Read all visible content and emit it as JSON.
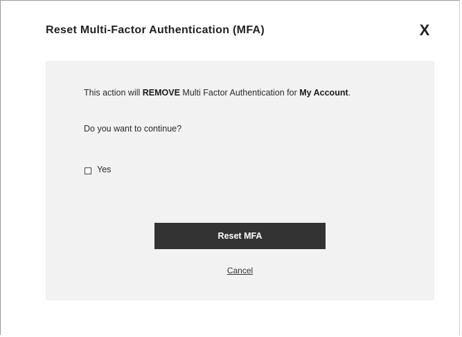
{
  "dialog": {
    "title": "Reset Multi-Factor Authentication (MFA)",
    "close_label": "X"
  },
  "message": {
    "prefix": "This action will ",
    "action": "REMOVE",
    "middle": " Multi Factor Authentication for ",
    "account": "My Account",
    "suffix": "."
  },
  "question": "Do you want to continue?",
  "confirm": {
    "label": "Yes",
    "checked": false
  },
  "actions": {
    "submit_label": "Reset MFA",
    "cancel_label": "Cancel"
  }
}
